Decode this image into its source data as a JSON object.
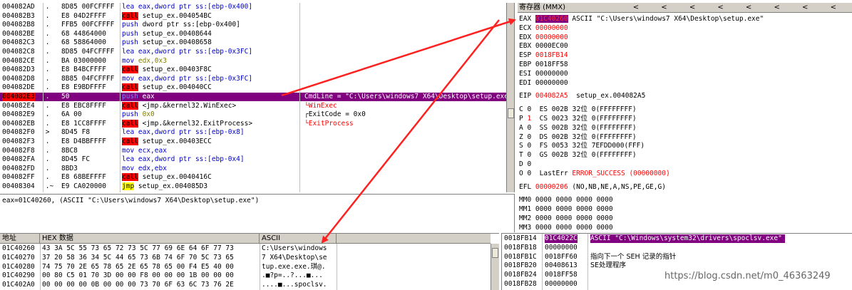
{
  "disasm": {
    "rows": [
      {
        "addr": "004082AD",
        "m": " . ",
        "hex": "8D85 00FCFFFF",
        "op": "lea",
        "arg": "eax,dword ptr ss:[ebp-0x400]",
        "k": "blue"
      },
      {
        "addr": "004082B3",
        "m": " . ",
        "hex": "E8 04D2FFFF",
        "op": "call",
        "arg": "setup_ex.004054BC",
        "k": "call"
      },
      {
        "addr": "004082B8",
        "m": " . ",
        "hex": "FFB5 00FCFFFF",
        "op": "push",
        "arg": "dword ptr ss:[ebp-0x400]",
        "k": "push"
      },
      {
        "addr": "004082BE",
        "m": " . ",
        "hex": "68 44864000",
        "op": "push",
        "arg": "setup_ex.00408644",
        "k": "push"
      },
      {
        "addr": "004082C3",
        "m": " . ",
        "hex": "68 58864000",
        "op": "push",
        "arg": "setup_ex.00408658",
        "k": "push"
      },
      {
        "addr": "004082C8",
        "m": " . ",
        "hex": "8D85 04FCFFFF",
        "op": "lea",
        "arg": "eax,dword ptr ss:[ebp-0x3FC]",
        "k": "blue"
      },
      {
        "addr": "004082CE",
        "m": " . ",
        "hex": "BA 03000000",
        "op": "mov",
        "arg": "edx,0x3",
        "k": "movimm"
      },
      {
        "addr": "004082D3",
        "m": " . ",
        "hex": "E8 B4BCFFFF",
        "op": "call",
        "arg": "setup_ex.00403F8C",
        "k": "call"
      },
      {
        "addr": "004082D8",
        "m": " . ",
        "hex": "8B85 04FCFFFF",
        "op": "mov",
        "arg": "eax,dword ptr ss:[ebp-0x3FC]",
        "k": "blue"
      },
      {
        "addr": "004082DE",
        "m": " . ",
        "hex": "E8 E9BDFFFF",
        "op": "call",
        "arg": "setup_ex.004040CC",
        "k": "call"
      },
      {
        "addr": "004082E3",
        "m": " . ",
        "hex": "50",
        "op": "push",
        "arg": "eax",
        "k": "selected"
      },
      {
        "addr": "004082E4",
        "m": " . ",
        "hex": "E8 EBC8FFFF",
        "op": "call",
        "arg": "<jmp.&kernel32.WinExec>",
        "k": "call"
      },
      {
        "addr": "004082E9",
        "m": " . ",
        "hex": "6A 00",
        "op": "push",
        "arg": "0x0",
        "k": "pushimm"
      },
      {
        "addr": "004082EB",
        "m": " . ",
        "hex": "E8 1CC8FFFF",
        "op": "call",
        "arg": "<jmp.&kernel32.ExitProcess>",
        "k": "call"
      },
      {
        "addr": "004082F0",
        "m": " > ",
        "hex": "8D45 F8",
        "op": "lea",
        "arg": "eax,dword ptr ss:[ebp-0x8]",
        "k": "blue"
      },
      {
        "addr": "004082F3",
        "m": " . ",
        "hex": "E8 D4BBFFFF",
        "op": "call",
        "arg": "setup_ex.00403ECC",
        "k": "call"
      },
      {
        "addr": "004082F8",
        "m": " . ",
        "hex": "8BC8",
        "op": "mov",
        "arg": "ecx,eax",
        "k": "blue"
      },
      {
        "addr": "004082FA",
        "m": " . ",
        "hex": "8D45 FC",
        "op": "lea",
        "arg": "eax,dword ptr ss:[ebp-0x4]",
        "k": "blue"
      },
      {
        "addr": "004082FD",
        "m": " . ",
        "hex": "8BD3",
        "op": "mov",
        "arg": "edx,ebx",
        "k": "blue"
      },
      {
        "addr": "004082FF",
        "m": " . ",
        "hex": "E8 68BEFFFF",
        "op": "call",
        "arg": "setup_ex.0040416C",
        "k": "call"
      },
      {
        "addr": "00408304",
        "m": " .~",
        "hex": "E9 CA020000",
        "op": "jmp",
        "arg": "setup_ex.004085D3",
        "k": "jmp"
      }
    ],
    "comments": [
      {
        "row": 10,
        "text": "CmdLine = \"C:\\Users\\windows7 X64\\Desktop\\setup.exe\"",
        "k": "sel"
      },
      {
        "row": 11,
        "text": "└WinExec",
        "k": "red"
      },
      {
        "row": 12,
        "text": "┌ExitCode = 0x0",
        "k": "black"
      },
      {
        "row": 13,
        "text": "└ExitProcess",
        "k": "red"
      }
    ]
  },
  "info_line": "eax=01C40260, (ASCII \"C:\\Users\\windows7 X64\\Desktop\\setup.exe\")",
  "registers": {
    "title": "寄存器 (MMX)",
    "nav": "< < < < < < < <",
    "gp": [
      {
        "name": "EAX",
        "val": "01C40260",
        "note": "ASCII \"C:\\Users\\windows7 X64\\Desktop\\setup.exe\"",
        "k": "selred"
      },
      {
        "name": "ECX",
        "val": "00000000",
        "note": "",
        "k": "red"
      },
      {
        "name": "EDX",
        "val": "00000000",
        "note": "",
        "k": "red"
      },
      {
        "name": "EBX",
        "val": "0000EC00",
        "note": "",
        "k": "black"
      },
      {
        "name": "ESP",
        "val": "0018FB14",
        "note": "",
        "k": "red"
      },
      {
        "name": "EBP",
        "val": "0018FF58",
        "note": "",
        "k": "black"
      },
      {
        "name": "ESI",
        "val": "00000000",
        "note": "",
        "k": "black"
      },
      {
        "name": "EDI",
        "val": "00000000",
        "note": "",
        "k": "black"
      }
    ],
    "eip": {
      "name": "EIP",
      "val": "004082A5",
      "note": "setup_ex.004082A5"
    },
    "flags": [
      {
        "f": "C",
        "v": "0",
        "seg": "ES",
        "sv": "002B",
        "bits": "32位",
        "info": "0(FFFFFFFF)",
        "red": false
      },
      {
        "f": "P",
        "v": "1",
        "seg": "CS",
        "sv": "0023",
        "bits": "32位",
        "info": "0(FFFFFFFF)",
        "red": true
      },
      {
        "f": "A",
        "v": "0",
        "seg": "SS",
        "sv": "002B",
        "bits": "32位",
        "info": "0(FFFFFFFF)",
        "red": false
      },
      {
        "f": "Z",
        "v": "0",
        "seg": "DS",
        "sv": "002B",
        "bits": "32位",
        "info": "0(FFFFFFFF)",
        "red": false
      },
      {
        "f": "S",
        "v": "0",
        "seg": "FS",
        "sv": "0053",
        "bits": "32位",
        "info": "7EFDD000(FFF)",
        "red": false
      },
      {
        "f": "T",
        "v": "0",
        "seg": "GS",
        "sv": "002B",
        "bits": "32位",
        "info": "0(FFFFFFFF)",
        "red": false
      },
      {
        "f": "D",
        "v": "0",
        "seg": "",
        "sv": "",
        "bits": "",
        "info": "",
        "red": false
      },
      {
        "f": "O",
        "v": "0",
        "seg": "LastErr",
        "sv": "",
        "bits": "",
        "info": "ERROR_SUCCESS (00000000)",
        "red": false
      }
    ],
    "efl": {
      "name": "EFL",
      "val": "00000206",
      "note": "(NO,NB,NE,A,NS,PE,GE,G)"
    },
    "mmx": [
      "MM0 0000 0000 0000 0000",
      "MM1 0000 0000 0000 0000",
      "MM2 0000 0000 0000 0000",
      "MM3 0000 0000 0000 0000"
    ]
  },
  "dump": {
    "col_addr": "地址",
    "col_hex": "HEX 数据",
    "col_ascii": "ASCII",
    "rows": [
      {
        "addr": "01C40260",
        "hex": "43 3A 5C 55 73 65 72 73 5C 77 69 6E 64 6F 77 73",
        "ascii": "C:\\Users\\windows"
      },
      {
        "addr": "01C40270",
        "hex": "37 20 58 36 34 5C 44 65 73 6B 74 6F 70 5C 73 65",
        "ascii": "7 X64\\Desktop\\se"
      },
      {
        "addr": "01C40280",
        "hex": "74 75 70 2E 65 78 65 2E 65 78 65 00 F4 E5 40 00",
        "ascii": "tup.exe.exe.琪@."
      },
      {
        "addr": "01C40290",
        "hex": "00 80 C5 01 70 3D 00 00 F8 00 00 00 1B 00 00 00",
        "ascii": ".■?p=..?...■..."
      },
      {
        "addr": "01C402A0",
        "hex": "00 00 00 00 0B 00 00 00 73 70 6F 63 6C 73 76 2E",
        "ascii": "....■...spoclsv."
      }
    ]
  },
  "stack": {
    "rows": [
      {
        "addr": "0018FB14",
        "val": "01C4022C",
        "note": "ASCII \"C:\\Windows\\system32\\drivers\\spoclsv.exe\"",
        "sel": true
      },
      {
        "addr": "0018FB18",
        "val": "00000000",
        "note": "",
        "sel": false
      },
      {
        "addr": "0018FB1C",
        "val": "0018FF60",
        "note": "指向下一个 SEH 记录的指针",
        "sel": false
      },
      {
        "addr": "0018FB20",
        "val": "00408613",
        "note": "SE处理程序",
        "sel": false
      },
      {
        "addr": "0018FB24",
        "val": "0018FF58",
        "note": "",
        "sel": false
      },
      {
        "addr": "0018FB28",
        "val": "00000000",
        "note": "",
        "sel": false
      }
    ]
  },
  "watermark": "https://blog.csdn.net/m0_46363249",
  "colors": {
    "selected": "#800080",
    "red": "#ff0000",
    "blue": "#0000cc",
    "arrow": "#ff2020"
  }
}
